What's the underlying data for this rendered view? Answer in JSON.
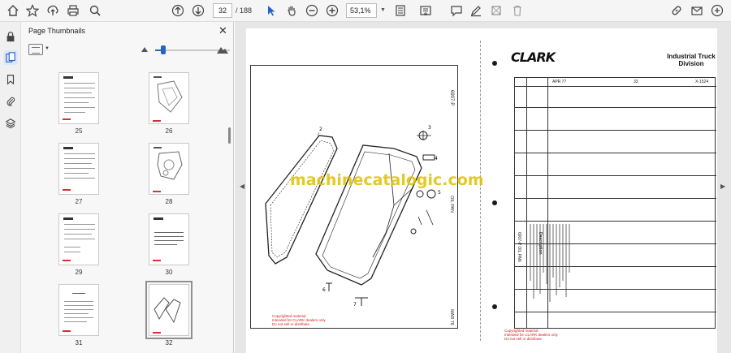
{
  "toolbar": {
    "page_current": "32",
    "page_total": "/ 188",
    "zoom": "53,1%",
    "icons": [
      "home-icon",
      "bookmark-star-icon",
      "upload-icon",
      "print-icon",
      "zoom-search-icon",
      "prev-page-icon",
      "next-page-icon",
      "select-cursor-icon",
      "hand-icon",
      "zoom-out-icon",
      "zoom-in-icon",
      "fit-page-icon",
      "scroll-mode-icon",
      "comment-icon",
      "draw-icon",
      "erase-icon",
      "delete-icon",
      "link-icon",
      "email-icon",
      "share-icon"
    ]
  },
  "sidebar": {
    "title": "Page Thumbnails",
    "close": "✕",
    "thumb_zoom": 0.1,
    "thumbnails": [
      {
        "label": "25"
      },
      {
        "label": "26"
      },
      {
        "label": "27"
      },
      {
        "label": "28"
      },
      {
        "label": "29"
      },
      {
        "label": "30"
      },
      {
        "label": "31"
      },
      {
        "label": "32"
      }
    ]
  },
  "document": {
    "brand": "CLARK",
    "division": "Industrial Truck Division",
    "watermark": "machinecatalogic.com",
    "left_code": "6907-P",
    "left_caption": "OIL PAN",
    "left_page": "MAR 76",
    "header_date": "APR 77",
    "header_num": "33",
    "header_ref": "X-1524",
    "section_label": "6907-P OIL PAN",
    "column_title": "Description",
    "copyright_left": [
      "Copyrighted material",
      "Intended for CLARK dealers only",
      "Do not sell or distribute"
    ],
    "copyright_right": [
      "Copyrighted material",
      "Intended for CLARK dealers only",
      "Do not sell or distribute"
    ]
  }
}
